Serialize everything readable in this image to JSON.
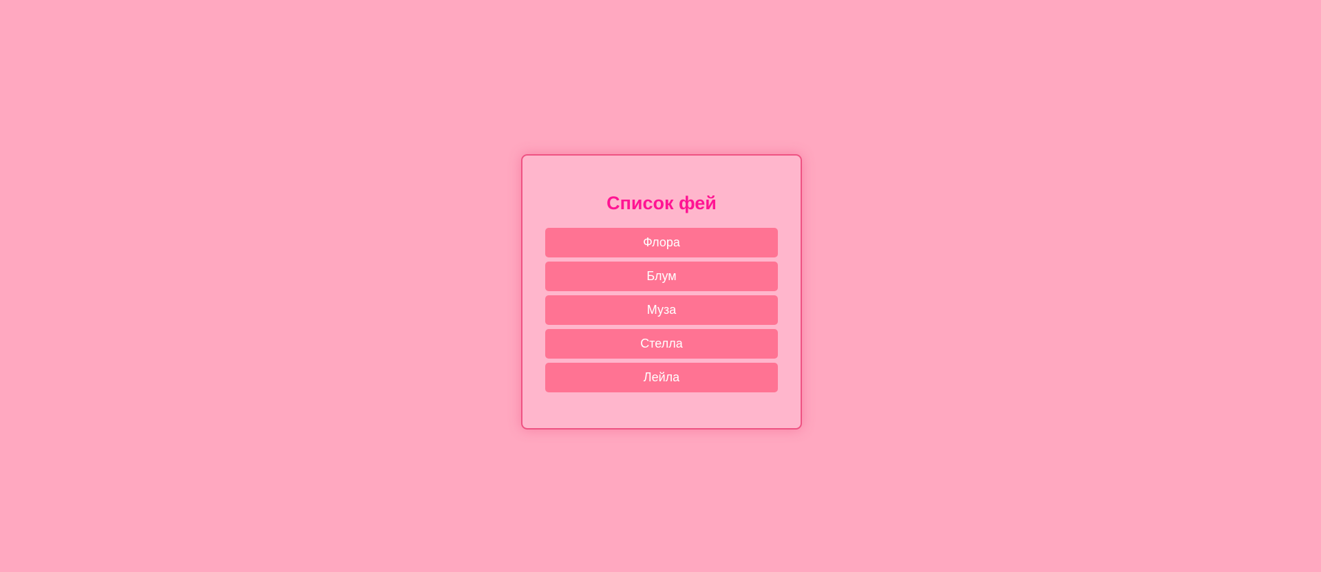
{
  "card": {
    "title": "Список фей"
  },
  "fairies": [
    {
      "label": "Флора"
    },
    {
      "label": "Блум"
    },
    {
      "label": "Муза"
    },
    {
      "label": "Стелла"
    },
    {
      "label": "Лейла"
    }
  ],
  "colors": {
    "background": "#ffa8c0",
    "card_background": "#ffb6cc",
    "card_border": "#ee5282",
    "title": "#ff1493",
    "item_background": "#ff7393",
    "item_text": "#ffffff"
  }
}
